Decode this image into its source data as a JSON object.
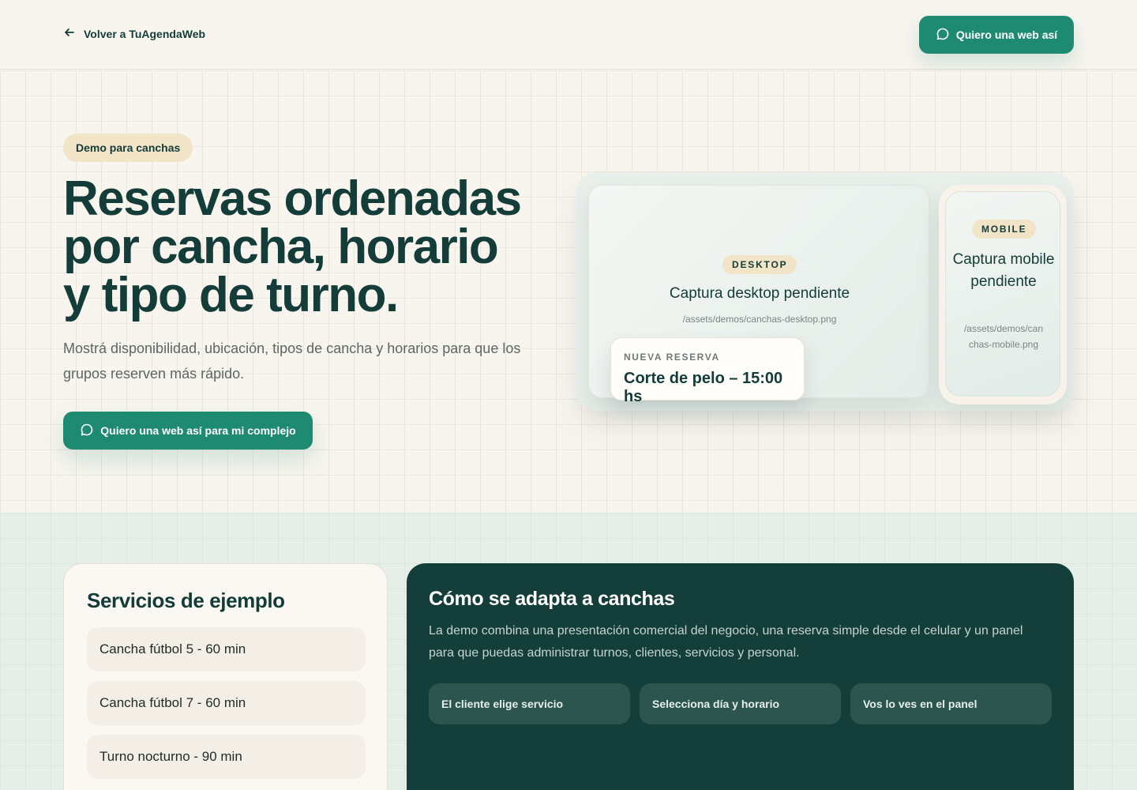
{
  "topbar": {
    "back_label": "Volver a TuAgendaWeb",
    "cta_label": "Quiero una web así"
  },
  "hero": {
    "badge": "Demo para canchas",
    "title_lines": [
      "Reservas ordenadas",
      "por cancha, horario",
      "y tipo de turno."
    ],
    "description": "Mostrá disponibilidad, ubicación, tipos de cancha y horarios para que los grupos reserven más rápido.",
    "cta_label": "Quiero una web así para mi complejo"
  },
  "mockup": {
    "desktop": {
      "pill": "DESKTOP",
      "title": "Captura desktop pendiente",
      "path": "/assets/demos/canchas-desktop.png"
    },
    "reservation": {
      "label": "NUEVA RESERVA",
      "value": "Corte de pelo – 15:00 hs"
    },
    "mobile": {
      "pill": "MOBILE",
      "title": "Captura mobile pendiente",
      "path": "/assets/demos/canchas-mobile.png"
    }
  },
  "services": {
    "title": "Servicios de ejemplo",
    "items": [
      "Cancha fútbol 5 - 60 min",
      "Cancha fútbol 7 - 60 min",
      "Turno nocturno - 90 min"
    ]
  },
  "how": {
    "title": "Cómo se adapta a canchas",
    "description": "La demo combina una presentación comercial del negocio, una reserva simple desde el celular y un panel para que puedas administrar turnos, clientes, servicios y personal.",
    "steps": [
      "El cliente elige servicio",
      "Selecciona día y horario",
      "Vos lo ves en el panel"
    ]
  },
  "colors": {
    "brand_green": "#1f8a72",
    "dark_green": "#143e3a",
    "badge_beige": "#f2e4c7",
    "background": "#f8f5ef"
  },
  "icons": {
    "back": "arrow-left-icon",
    "chat": "chat-bubble-icon"
  }
}
